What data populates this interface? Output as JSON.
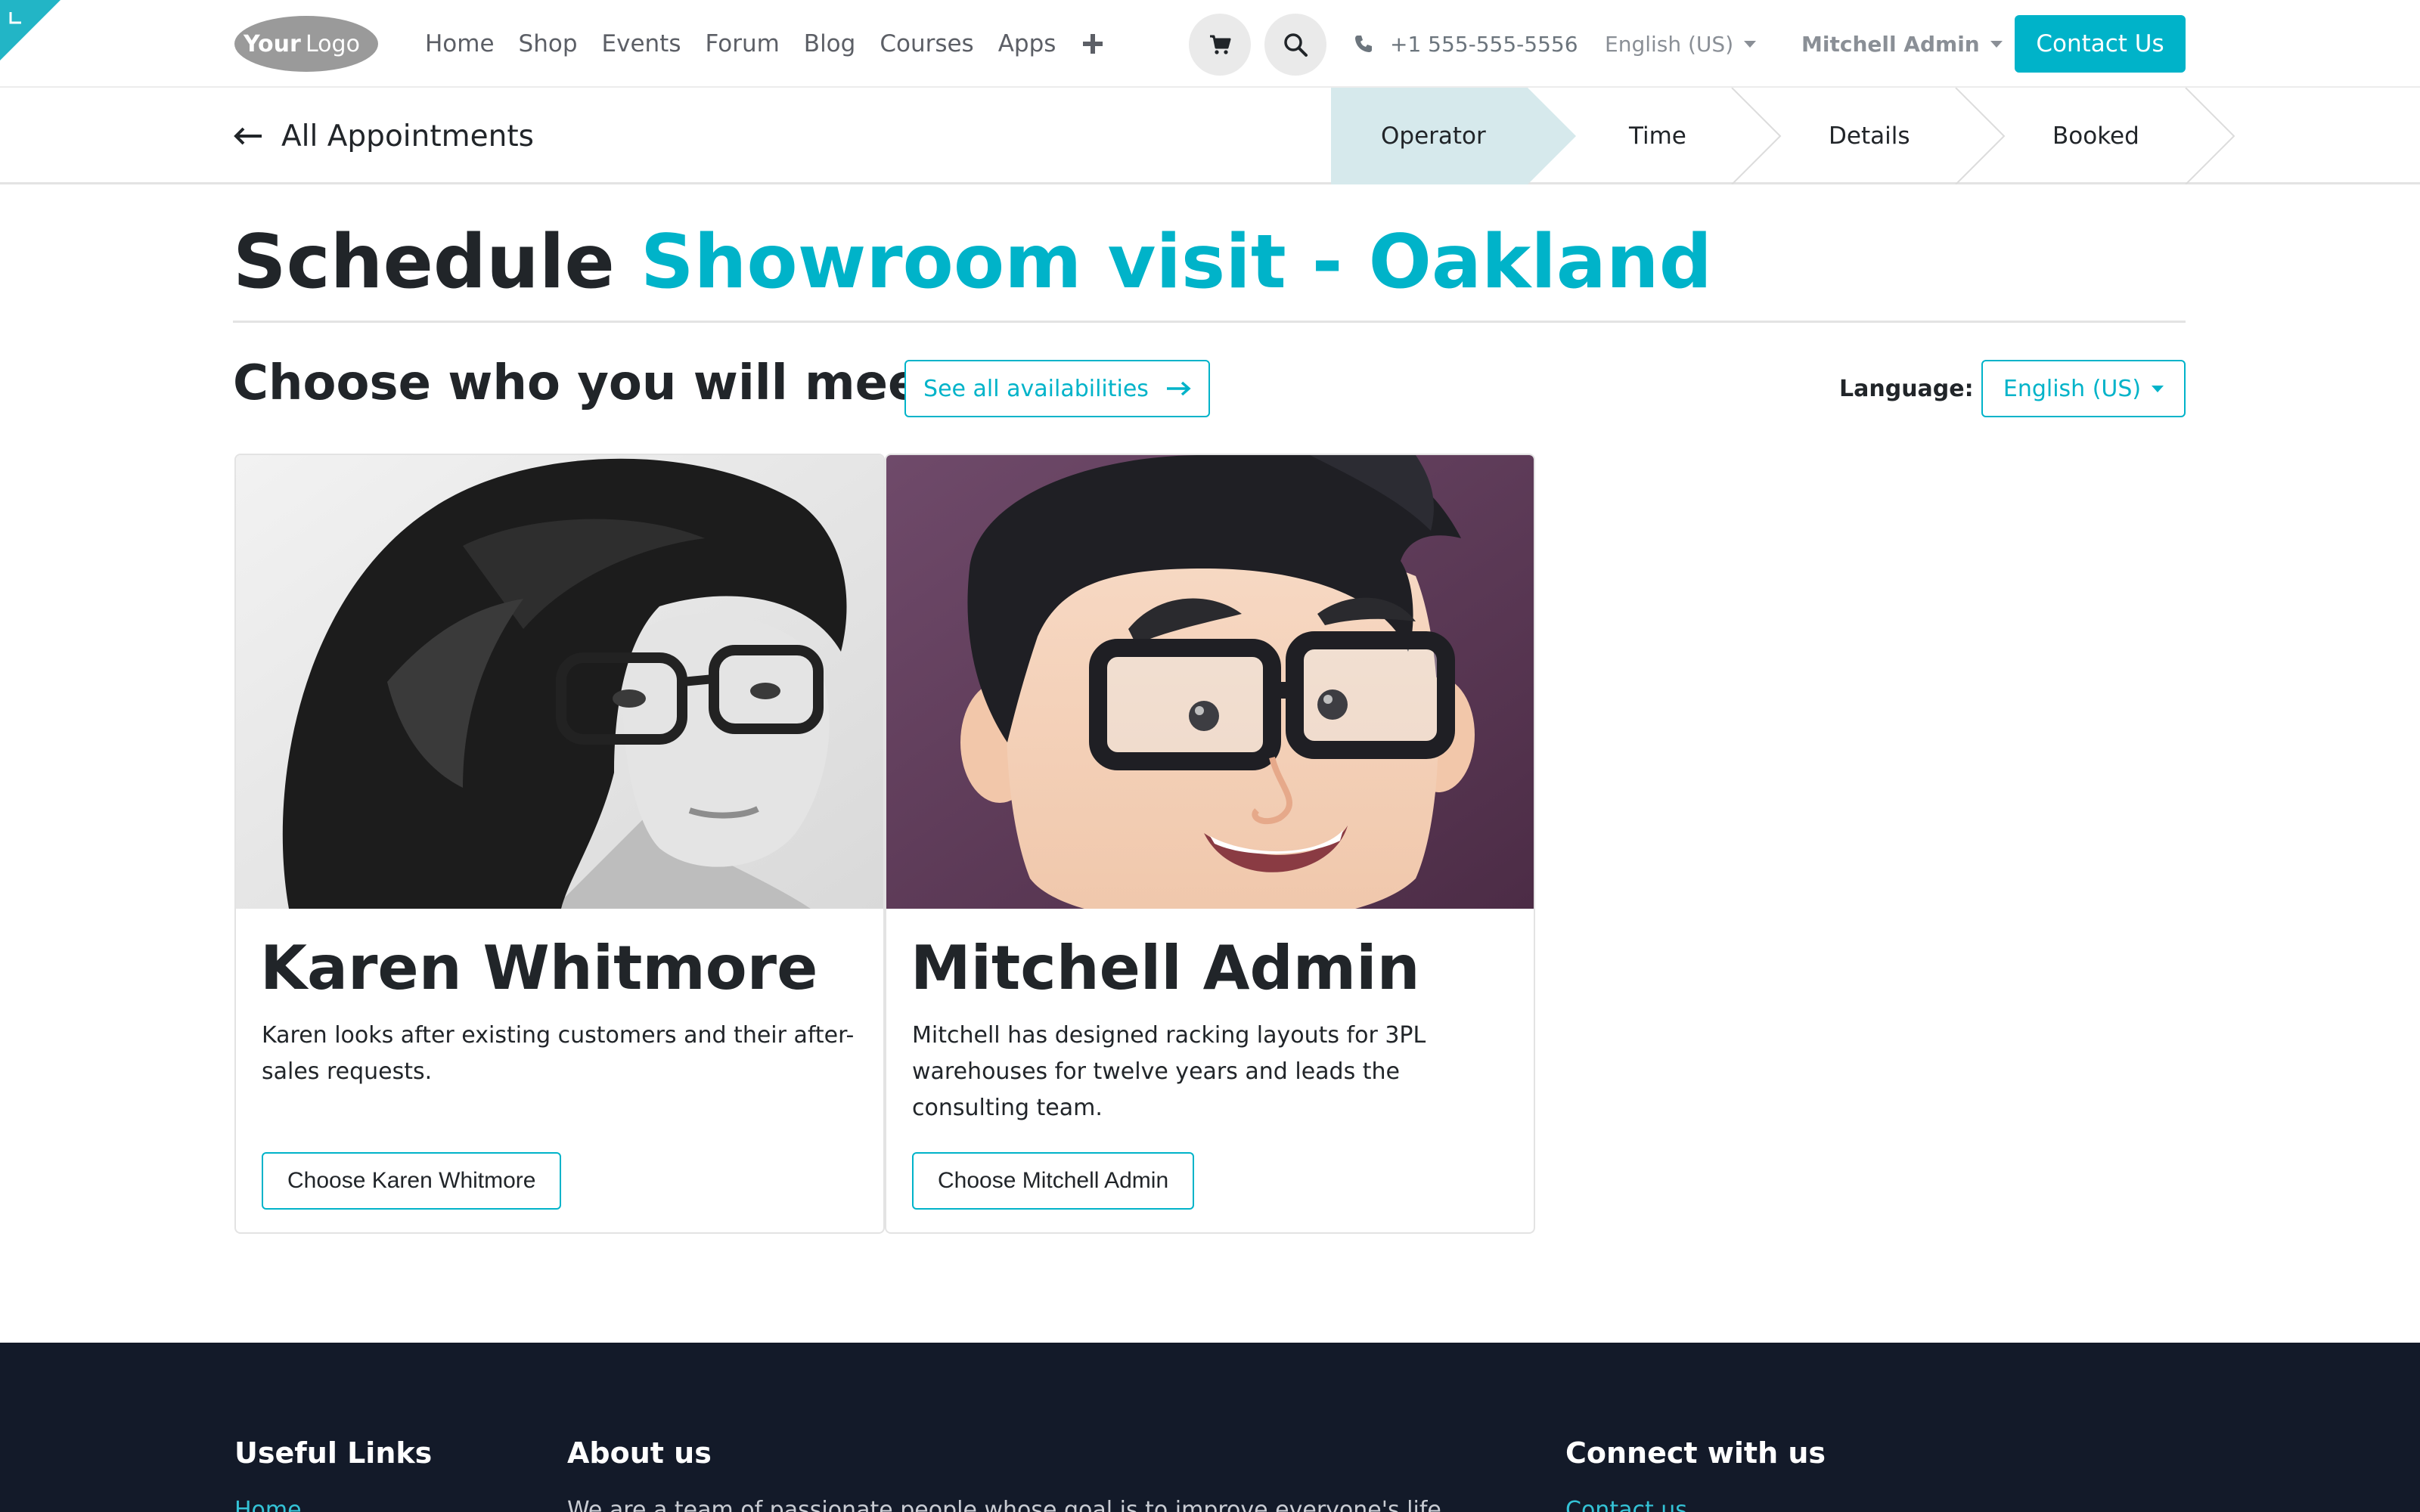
{
  "colors": {
    "accent": "#00b3c9",
    "step_active_bg": "#d6e9ec",
    "footer_bg": "#131a29",
    "text": "#212529"
  },
  "header": {
    "logo_text": "YourLogo",
    "nav": [
      "Home",
      "Shop",
      "Events",
      "Forum",
      "Blog",
      "Courses",
      "Apps"
    ],
    "add_icon": "plus-icon",
    "cart_icon": "cart-icon",
    "search_icon": "search-icon",
    "phone_icon": "phone-icon",
    "phone": "+1 555-555-5556",
    "language": "English (US)",
    "user": "Mitchell Admin",
    "contact_label": "Contact Us"
  },
  "progress": {
    "back_label": "All Appointments",
    "back_icon": "arrow-left-icon",
    "steps": [
      "Operator",
      "Time",
      "Details",
      "Booked"
    ],
    "active_step": "Operator"
  },
  "main": {
    "title_prefix": "Schedule",
    "title_accent": "Showroom visit - Oakland",
    "choose_heading": "Choose who you will meet or",
    "availability_label": "See all availabilities",
    "availability_icon": "arrow-right-icon",
    "language_label": "Language:",
    "language_value": "English (US)"
  },
  "operators": [
    {
      "name": "Karen Whitmore",
      "description": "Karen looks after existing customers and their after-sales requests.",
      "button": "Choose Karen Whitmore",
      "photo": "karen-photo"
    },
    {
      "name": "Mitchell Admin",
      "description": "Mitchell has designed racking layouts for 3PL warehouses for twelve years and leads the consulting team.",
      "button": "Choose Mitchell Admin",
      "photo": "mitchell-avatar"
    }
  ],
  "footer": {
    "useful_links": "Useful Links",
    "about_us": "About us",
    "connect": "Connect with us",
    "link_peek": "Home",
    "about_peek": "We are a team of passionate people whose goal is to improve everyone's life",
    "contact_peek": "Contact us"
  }
}
